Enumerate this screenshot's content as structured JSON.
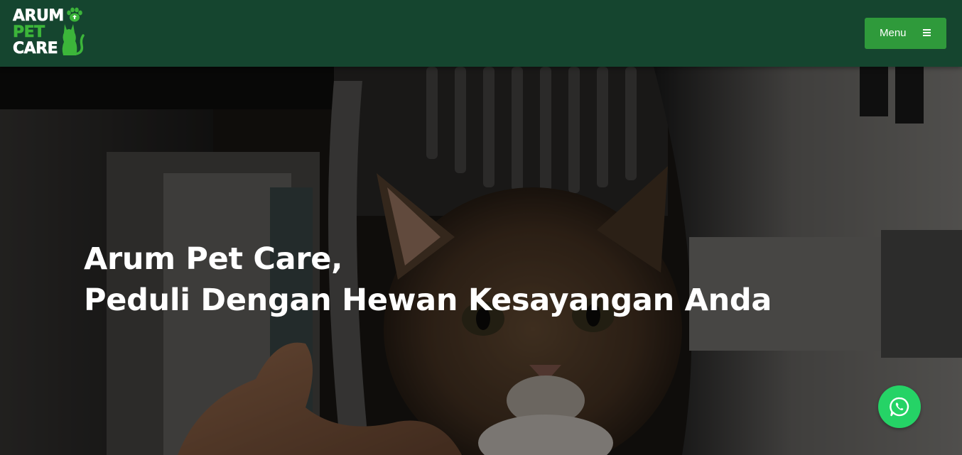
{
  "brand": {
    "line1": "ARUM",
    "line2": "PET",
    "line3": "CARE"
  },
  "nav": {
    "menu_label": "Menu",
    "menu_icon": "hamburger-icon"
  },
  "hero": {
    "headline_line1": "Arum Pet Care,",
    "headline_line2": "Peduli Dengan Hewan Kesayangan Anda",
    "background": "cat-in-pet-carrier-photo"
  },
  "floating": {
    "whatsapp_icon": "whatsapp-icon"
  },
  "colors": {
    "navbar_bg": "#15452f",
    "accent_green": "#2f9a3b",
    "brand_green": "#3cb53a",
    "whatsapp_green": "#25d366"
  }
}
